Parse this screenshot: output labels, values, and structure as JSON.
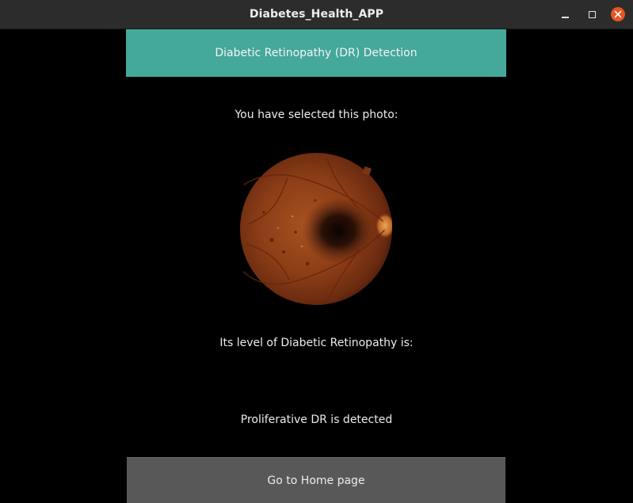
{
  "window": {
    "title": "Diabetes_Health_APP"
  },
  "header": {
    "title": "Diabetic Retinopathy (DR) Detection"
  },
  "main": {
    "selected_label": "You have selected this photo:",
    "level_label": "Its level of Diabetic Retinopathy is:",
    "result_text": "Proliferative DR is detected",
    "image": "retinal-fundus-photo"
  },
  "actions": {
    "home_label": "Go to Home page"
  },
  "colors": {
    "header_bg": "#44a89a",
    "button_bg": "#585858",
    "close_button": "#e95420",
    "background": "#000000"
  }
}
